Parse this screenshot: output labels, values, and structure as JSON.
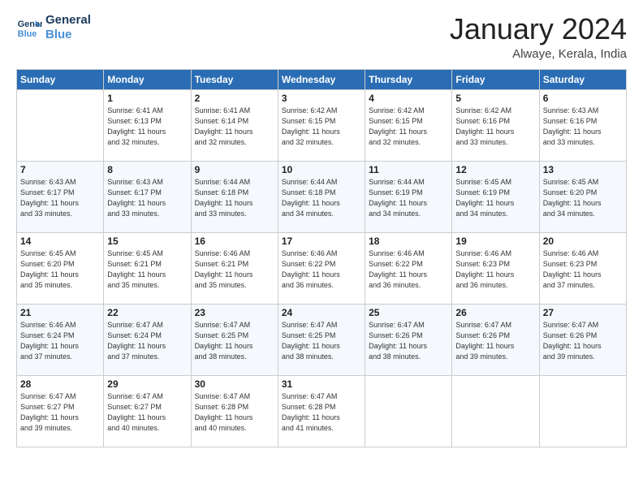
{
  "logo": {
    "line1": "General",
    "line2": "Blue"
  },
  "title": "January 2024",
  "location": "Alwaye, Kerala, India",
  "headers": [
    "Sunday",
    "Monday",
    "Tuesday",
    "Wednesday",
    "Thursday",
    "Friday",
    "Saturday"
  ],
  "weeks": [
    [
      {
        "day": "",
        "info": ""
      },
      {
        "day": "1",
        "info": "Sunrise: 6:41 AM\nSunset: 6:13 PM\nDaylight: 11 hours\nand 32 minutes."
      },
      {
        "day": "2",
        "info": "Sunrise: 6:41 AM\nSunset: 6:14 PM\nDaylight: 11 hours\nand 32 minutes."
      },
      {
        "day": "3",
        "info": "Sunrise: 6:42 AM\nSunset: 6:15 PM\nDaylight: 11 hours\nand 32 minutes."
      },
      {
        "day": "4",
        "info": "Sunrise: 6:42 AM\nSunset: 6:15 PM\nDaylight: 11 hours\nand 32 minutes."
      },
      {
        "day": "5",
        "info": "Sunrise: 6:42 AM\nSunset: 6:16 PM\nDaylight: 11 hours\nand 33 minutes."
      },
      {
        "day": "6",
        "info": "Sunrise: 6:43 AM\nSunset: 6:16 PM\nDaylight: 11 hours\nand 33 minutes."
      }
    ],
    [
      {
        "day": "7",
        "info": "Sunrise: 6:43 AM\nSunset: 6:17 PM\nDaylight: 11 hours\nand 33 minutes."
      },
      {
        "day": "8",
        "info": "Sunrise: 6:43 AM\nSunset: 6:17 PM\nDaylight: 11 hours\nand 33 minutes."
      },
      {
        "day": "9",
        "info": "Sunrise: 6:44 AM\nSunset: 6:18 PM\nDaylight: 11 hours\nand 33 minutes."
      },
      {
        "day": "10",
        "info": "Sunrise: 6:44 AM\nSunset: 6:18 PM\nDaylight: 11 hours\nand 34 minutes."
      },
      {
        "day": "11",
        "info": "Sunrise: 6:44 AM\nSunset: 6:19 PM\nDaylight: 11 hours\nand 34 minutes."
      },
      {
        "day": "12",
        "info": "Sunrise: 6:45 AM\nSunset: 6:19 PM\nDaylight: 11 hours\nand 34 minutes."
      },
      {
        "day": "13",
        "info": "Sunrise: 6:45 AM\nSunset: 6:20 PM\nDaylight: 11 hours\nand 34 minutes."
      }
    ],
    [
      {
        "day": "14",
        "info": "Sunrise: 6:45 AM\nSunset: 6:20 PM\nDaylight: 11 hours\nand 35 minutes."
      },
      {
        "day": "15",
        "info": "Sunrise: 6:45 AM\nSunset: 6:21 PM\nDaylight: 11 hours\nand 35 minutes."
      },
      {
        "day": "16",
        "info": "Sunrise: 6:46 AM\nSunset: 6:21 PM\nDaylight: 11 hours\nand 35 minutes."
      },
      {
        "day": "17",
        "info": "Sunrise: 6:46 AM\nSunset: 6:22 PM\nDaylight: 11 hours\nand 36 minutes."
      },
      {
        "day": "18",
        "info": "Sunrise: 6:46 AM\nSunset: 6:22 PM\nDaylight: 11 hours\nand 36 minutes."
      },
      {
        "day": "19",
        "info": "Sunrise: 6:46 AM\nSunset: 6:23 PM\nDaylight: 11 hours\nand 36 minutes."
      },
      {
        "day": "20",
        "info": "Sunrise: 6:46 AM\nSunset: 6:23 PM\nDaylight: 11 hours\nand 37 minutes."
      }
    ],
    [
      {
        "day": "21",
        "info": "Sunrise: 6:46 AM\nSunset: 6:24 PM\nDaylight: 11 hours\nand 37 minutes."
      },
      {
        "day": "22",
        "info": "Sunrise: 6:47 AM\nSunset: 6:24 PM\nDaylight: 11 hours\nand 37 minutes."
      },
      {
        "day": "23",
        "info": "Sunrise: 6:47 AM\nSunset: 6:25 PM\nDaylight: 11 hours\nand 38 minutes."
      },
      {
        "day": "24",
        "info": "Sunrise: 6:47 AM\nSunset: 6:25 PM\nDaylight: 11 hours\nand 38 minutes."
      },
      {
        "day": "25",
        "info": "Sunrise: 6:47 AM\nSunset: 6:26 PM\nDaylight: 11 hours\nand 38 minutes."
      },
      {
        "day": "26",
        "info": "Sunrise: 6:47 AM\nSunset: 6:26 PM\nDaylight: 11 hours\nand 39 minutes."
      },
      {
        "day": "27",
        "info": "Sunrise: 6:47 AM\nSunset: 6:26 PM\nDaylight: 11 hours\nand 39 minutes."
      }
    ],
    [
      {
        "day": "28",
        "info": "Sunrise: 6:47 AM\nSunset: 6:27 PM\nDaylight: 11 hours\nand 39 minutes."
      },
      {
        "day": "29",
        "info": "Sunrise: 6:47 AM\nSunset: 6:27 PM\nDaylight: 11 hours\nand 40 minutes."
      },
      {
        "day": "30",
        "info": "Sunrise: 6:47 AM\nSunset: 6:28 PM\nDaylight: 11 hours\nand 40 minutes."
      },
      {
        "day": "31",
        "info": "Sunrise: 6:47 AM\nSunset: 6:28 PM\nDaylight: 11 hours\nand 41 minutes."
      },
      {
        "day": "",
        "info": ""
      },
      {
        "day": "",
        "info": ""
      },
      {
        "day": "",
        "info": ""
      }
    ]
  ]
}
